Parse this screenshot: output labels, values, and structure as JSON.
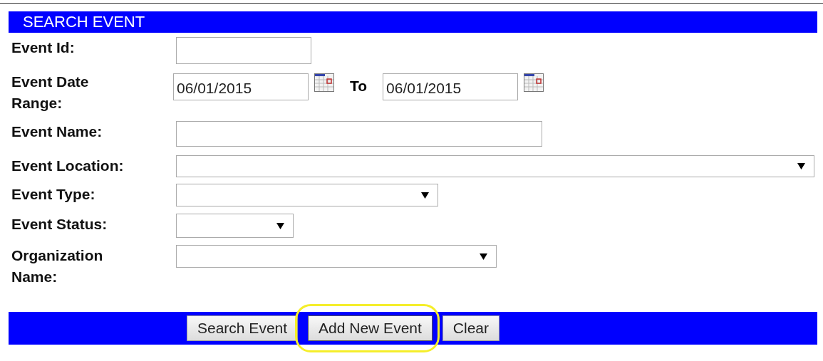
{
  "header": {
    "title": "SEARCH EVENT"
  },
  "fields": [
    {
      "kind": "text",
      "label": "Event Id:"
    },
    {
      "kind": "daterange",
      "label": "Event Date Range:",
      "from": "06/01/2015",
      "separator": "To",
      "to": "06/01/2015"
    },
    {
      "kind": "text",
      "label": "Event Name:"
    },
    {
      "kind": "select",
      "label": "Event Location:"
    },
    {
      "kind": "select",
      "label": "Event Type:"
    },
    {
      "kind": "select",
      "label": "Event Status:"
    },
    {
      "kind": "select",
      "label": "Organization Name:"
    }
  ],
  "buttons": [
    {
      "label": "Search Event",
      "highlighted": false
    },
    {
      "label": "Add New Event",
      "highlighted": true
    },
    {
      "label": "Clear",
      "highlighted": false
    }
  ]
}
